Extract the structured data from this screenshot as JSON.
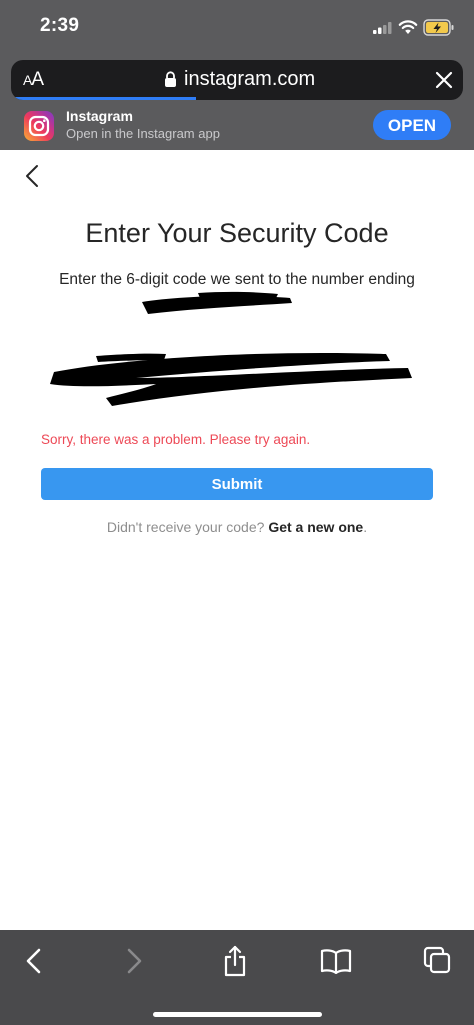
{
  "status_bar": {
    "time": "2:39"
  },
  "browser": {
    "text_size_label_small": "A",
    "text_size_label_large": "A",
    "url": "instagram.com",
    "load_progress": 0.41
  },
  "smart_banner": {
    "title": "Instagram",
    "subtitle": "Open in the Instagram app",
    "open_label": "OPEN"
  },
  "page": {
    "title": "Enter Your Security Code",
    "instructions": "Enter the 6-digit code we sent to the number ending",
    "error": "Sorry, there was a problem. Please try again.",
    "submit_label": "Submit",
    "resend_prompt": "Didn't receive your code?",
    "resend_link": "Get a new one",
    "resend_suffix": "."
  },
  "colors": {
    "accent_blue": "#3897f0",
    "error_red": "#ed4956",
    "safari_blue": "#2f7df6"
  }
}
